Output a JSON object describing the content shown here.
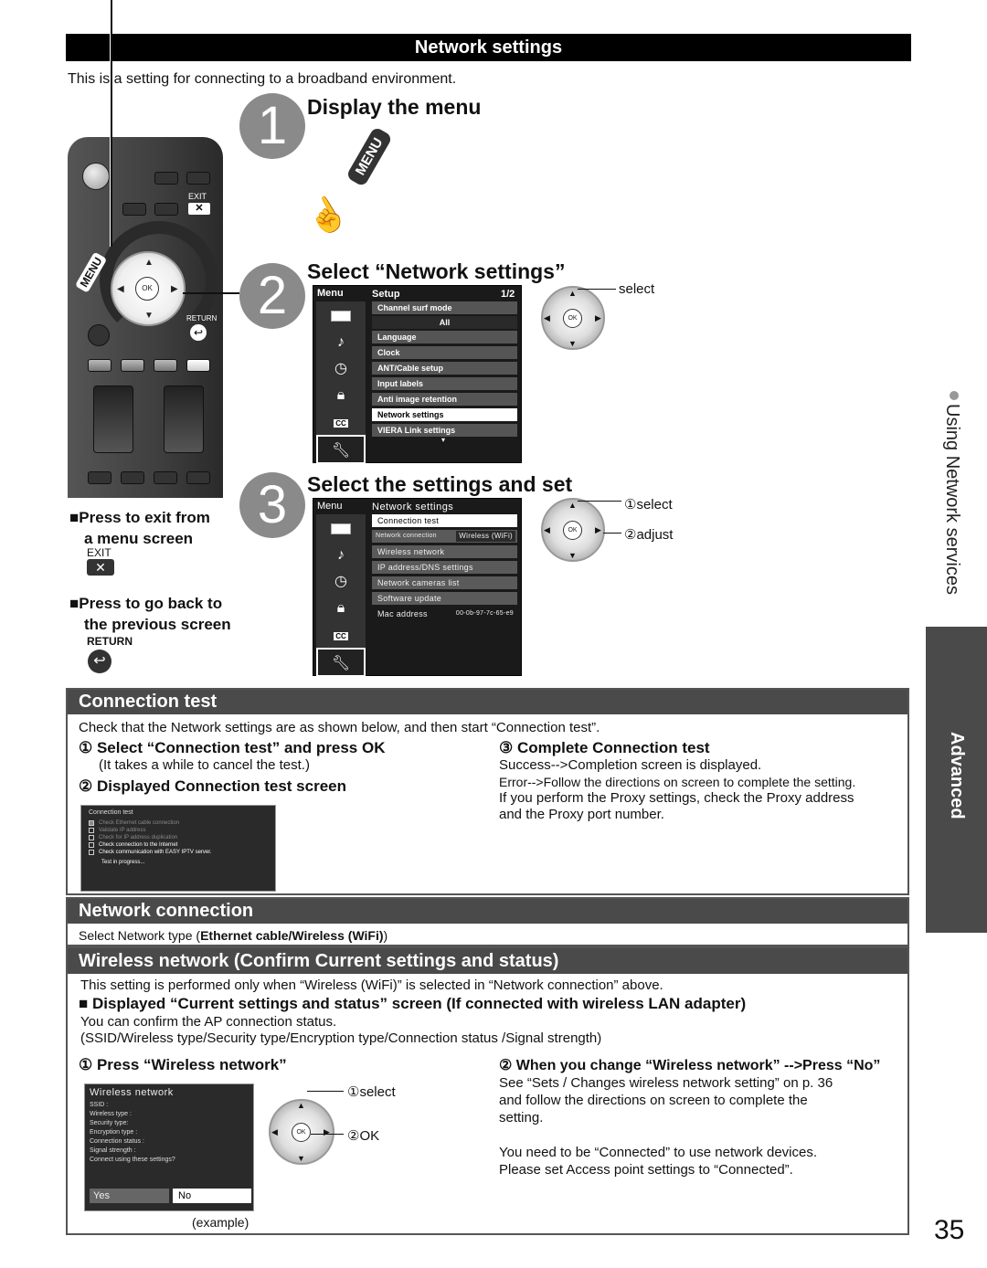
{
  "header": {
    "title": "Network settings",
    "intro": "This is a setting for connecting to a broadband environment."
  },
  "steps": [
    {
      "number": "1",
      "title": "Display the menu",
      "button_label": "MENU"
    },
    {
      "number": "2",
      "title": "Select “Network settings”",
      "dpad_label": "select"
    },
    {
      "number": "3",
      "title": "Select the settings and set",
      "dpad_labels": [
        "①select",
        "②adjust"
      ]
    }
  ],
  "remote": {
    "exit_label": "EXIT",
    "menu_label": "MENU",
    "return_label": "RETURN",
    "ok_label": "OK"
  },
  "notes": {
    "exit_title_1": "Press to exit from",
    "exit_title_2": "a menu screen",
    "exit_label": "EXIT",
    "return_title_1": "Press to go back to",
    "return_title_2": "the previous screen",
    "return_label": "RETURN",
    "bullet": "■"
  },
  "setup_menu": {
    "left_title": "Menu",
    "title": "Setup",
    "page": "1/2",
    "tabs": [
      "picture-icon",
      "audio-icon",
      "timer-icon",
      "lock-icon",
      "cc-icon",
      "setup-icon"
    ],
    "cc_label": "CC",
    "items": [
      {
        "label": "Channel surf mode",
        "selected": false
      },
      {
        "label": "All",
        "selected": false,
        "value": true
      },
      {
        "label": "Language",
        "selected": false
      },
      {
        "label": "Clock",
        "selected": false
      },
      {
        "label": "ANT/Cable setup",
        "selected": false
      },
      {
        "label": "Input labels",
        "selected": false
      },
      {
        "label": "Anti image retention",
        "selected": false
      },
      {
        "label": "Network settings",
        "selected": true
      },
      {
        "label": "VIERA Link settings",
        "selected": false
      }
    ],
    "more_indicator": "▾"
  },
  "network_menu": {
    "left_title": "Menu",
    "title": "Network settings",
    "items": [
      {
        "label": "Connection test",
        "selected": true
      },
      {
        "label": "Network connection",
        "value": "Wireless (WiFi)"
      },
      {
        "label": "Wireless network"
      },
      {
        "label": "IP address/DNS settings"
      },
      {
        "label": "Network cameras list"
      },
      {
        "label": "Software update"
      },
      {
        "label": "Mac address",
        "value": "00-0b-97-7c-65-e9"
      }
    ]
  },
  "connection_test": {
    "heading": "Connection test",
    "intro": "Check that the Network settings are as shown below, and then start “Connection test”.",
    "step1": "① Select “Connection test” and press OK",
    "step1_note": "(It takes a while to cancel the test.)",
    "step2": "② Displayed Connection test screen",
    "step3": "③ Complete Connection test",
    "step3_lines": [
      "Success-->Completion screen is displayed.",
      "Error-->Follow the directions on screen to complete the setting.",
      "If you perform the Proxy settings, check the Proxy address",
      "and the Proxy port number."
    ],
    "screen": {
      "title": "Connection test",
      "checks": [
        {
          "label": "Check Ethernet cable connection",
          "checked": true,
          "active": false
        },
        {
          "label": "Validate IP address",
          "checked": false,
          "active": false
        },
        {
          "label": "Check for IP address duplication",
          "checked": false,
          "active": false
        },
        {
          "label": "Check connection to the Internet",
          "checked": false,
          "active": true
        },
        {
          "label": "Check communication with EASY IPTV server.",
          "checked": false,
          "active": true
        }
      ],
      "status": "Test in progress..."
    }
  },
  "network_connection": {
    "heading": "Network connection",
    "text_prefix": "Select Network type (",
    "text_bold": "Ethernet cable/Wireless (WiFi)",
    "text_suffix": ")"
  },
  "wireless_network": {
    "heading": "Wireless network (Confirm Current settings and status)",
    "intro": "This setting is performed only when “Wireless (WiFi)” is selected in “Network connection” above.",
    "subheading": "■ Displayed “Current settings and status” screen (If connected with wireless LAN adapter)",
    "line1": "You can confirm the AP connection status.",
    "line2": "(SSID/Wireless type/Security type/Encryption type/Connection status /Signal strength)",
    "step1": "① Press “Wireless network”",
    "step2": "② When you change “Wireless network” -->Press “No”",
    "step2_lines": [
      "See “Sets / Changes wireless network setting” on p. 36",
      "and follow the directions on screen to complete the",
      "setting."
    ],
    "step2_lines_b": [
      "You need to be “Connected” to use network devices.",
      "Please set Access point settings to “Connected”."
    ],
    "dpad_labels": [
      "①select",
      "②OK"
    ],
    "screen": {
      "title": "Wireless network",
      "fields": [
        "SSID :",
        "Wireless type :",
        "Security type:",
        "Encryption type :",
        "Connection status :",
        "Signal strength :",
        "Connect using these settings?"
      ],
      "yes": "Yes",
      "no": "No"
    },
    "caption": "(example)"
  },
  "side": {
    "section": "Using Network services",
    "tab": "Advanced"
  },
  "page_number": "35"
}
